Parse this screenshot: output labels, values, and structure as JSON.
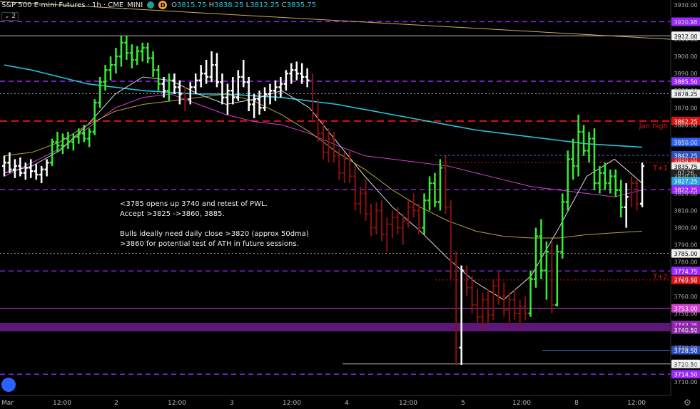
{
  "header": {
    "symbol": "S&P 500 E-mini Futures",
    "interval": "1h",
    "exchange": "CME_MINI",
    "badge": "D",
    "ohlc": {
      "o_label": "O",
      "o": "3815.75",
      "h_label": "H",
      "h": "3838.25",
      "l_label": "L",
      "l": "3812.25",
      "c_label": "C",
      "c": "3835.75"
    },
    "indicators_collapsed": "2"
  },
  "annotation_text": "<3785 opens up 3740 and retest of PWL.\nAccept >3825 ->3860, 3885.\n\nBulls ideally need daily close >3820 (approx 50dma)\n>3860 for potential test of ATH in future sessions.",
  "colors": {
    "bg": "#000000",
    "up": "#33ee33",
    "down": "#8b1010",
    "neutral": "#ffffff",
    "purple": "#9c27ff",
    "red_level": "#e01010",
    "cyan": "#26c6da",
    "tan": "#c8b060",
    "magenta": "#d040d0",
    "grey_line": "#cccccc"
  },
  "chart_data": {
    "type": "candlestick",
    "title": "S&P 500 E-mini Futures 1h",
    "y_range": [
      3705,
      3935
    ],
    "y_ticks": [
      "3930.00",
      "3920.00",
      "3910.00",
      "3900.00",
      "3890.00",
      "3880.00",
      "3870.00",
      "3860.00",
      "3850.00",
      "3840.00",
      "3830.00",
      "3820.00",
      "3810.00",
      "3800.00",
      "3790.00",
      "3780.00",
      "3770.00",
      "3760.00",
      "3750.00",
      "3740.00",
      "3730.00",
      "3720.00",
      "3710.00"
    ],
    "x_labels": [
      "Mar",
      "12:00",
      "2",
      "12:00",
      "3",
      "12:00",
      "4",
      "12:00",
      "5",
      "12:00",
      "8",
      "12:00"
    ],
    "levels": [
      {
        "value": 3920.25,
        "label": "3920.25",
        "style": "purple-dash"
      },
      {
        "value": 3912.0,
        "label": "3912.00",
        "style": "white-solid"
      },
      {
        "value": 3885.5,
        "label": "3885.50",
        "style": "purple-dash"
      },
      {
        "value": 3878.25,
        "label": "3878.25",
        "style": "white-dot"
      },
      {
        "value": 3862.25,
        "label": "3862.25",
        "style": "red-dash",
        "note": "Jan high"
      },
      {
        "value": 3850.0,
        "label": "3850.00",
        "style": "cyan"
      },
      {
        "value": 3842.25,
        "label": "3842.25",
        "style": "blue-dot"
      },
      {
        "value": 3838.0,
        "label": "3838.00",
        "style": "red-dot",
        "note": "T+1"
      },
      {
        "value": 3835.75,
        "label": "3835.75",
        "style": "price"
      },
      {
        "value": 3827.25,
        "label": "3827.25",
        "style": "cyan-tag"
      },
      {
        "value": 3822.25,
        "label": "3822.25",
        "style": "purple-dash"
      },
      {
        "value": 3785.0,
        "label": "3785.00",
        "style": "white-dot"
      },
      {
        "value": 3774.75,
        "label": "3774.75",
        "style": "purple-dash",
        "note": "T+2"
      },
      {
        "value": 3769.5,
        "label": "3769.50",
        "style": "red-dot"
      },
      {
        "value": 3753.0,
        "label": "3753.00",
        "style": "magenta-solid"
      },
      {
        "value": 3743.25,
        "label": "3743.25",
        "style": "purple-band"
      },
      {
        "value": 3740.5,
        "label": "3740.50",
        "style": "purple-band"
      },
      {
        "value": 3728.5,
        "label": "3728.50",
        "style": "blue-solid"
      },
      {
        "value": 3720.5,
        "label": "3720.50",
        "style": "white-solid"
      },
      {
        "value": 3714.5,
        "label": "3714.50",
        "style": "purple-dash"
      }
    ],
    "countdown": "07:26",
    "series_candles_note": "OHLC values for each hourly bar",
    "candles": [
      [
        3836,
        3842,
        3830,
        3838,
        "w"
      ],
      [
        3838,
        3844,
        3832,
        3834,
        "w"
      ],
      [
        3834,
        3840,
        3829,
        3836,
        "w"
      ],
      [
        3836,
        3841,
        3830,
        3832,
        "w"
      ],
      [
        3832,
        3838,
        3828,
        3835,
        "w"
      ],
      [
        3835,
        3840,
        3829,
        3833,
        "w"
      ],
      [
        3833,
        3837,
        3828,
        3831,
        "w"
      ],
      [
        3831,
        3836,
        3826,
        3834,
        "w"
      ],
      [
        3834,
        3840,
        3830,
        3838,
        "w"
      ],
      [
        3838,
        3852,
        3836,
        3850,
        "u"
      ],
      [
        3850,
        3856,
        3844,
        3848,
        "u"
      ],
      [
        3848,
        3855,
        3843,
        3852,
        "u"
      ],
      [
        3852,
        3856,
        3846,
        3850,
        "u"
      ],
      [
        3850,
        3855,
        3845,
        3853,
        "u"
      ],
      [
        3853,
        3858,
        3849,
        3855,
        "u"
      ],
      [
        3855,
        3860,
        3850,
        3852,
        "u"
      ],
      [
        3852,
        3858,
        3847,
        3856,
        "u"
      ],
      [
        3856,
        3875,
        3854,
        3873,
        "u"
      ],
      [
        3873,
        3888,
        3870,
        3885,
        "u"
      ],
      [
        3885,
        3895,
        3880,
        3892,
        "u"
      ],
      [
        3892,
        3900,
        3886,
        3895,
        "u"
      ],
      [
        3895,
        3905,
        3890,
        3900,
        "u"
      ],
      [
        3900,
        3912,
        3894,
        3908,
        "u"
      ],
      [
        3908,
        3912,
        3898,
        3902,
        "u"
      ],
      [
        3902,
        3907,
        3893,
        3898,
        "u"
      ],
      [
        3898,
        3906,
        3895,
        3903,
        "u"
      ],
      [
        3903,
        3908,
        3897,
        3905,
        "u"
      ],
      [
        3905,
        3908,
        3896,
        3899,
        "u"
      ],
      [
        3899,
        3903,
        3888,
        3892,
        "u"
      ],
      [
        3892,
        3895,
        3880,
        3884,
        "u"
      ],
      [
        3884,
        3888,
        3876,
        3880,
        "w"
      ],
      [
        3880,
        3890,
        3874,
        3886,
        "u"
      ],
      [
        3886,
        3890,
        3878,
        3882,
        "w"
      ],
      [
        3882,
        3886,
        3872,
        3878,
        "w"
      ],
      [
        3878,
        3882,
        3868,
        3875,
        "d"
      ],
      [
        3875,
        3885,
        3872,
        3882,
        "w"
      ],
      [
        3882,
        3890,
        3878,
        3886,
        "w"
      ],
      [
        3886,
        3895,
        3882,
        3890,
        "w"
      ],
      [
        3890,
        3898,
        3884,
        3888,
        "w"
      ],
      [
        3888,
        3903,
        3885,
        3895,
        "w"
      ],
      [
        3895,
        3902,
        3882,
        3885,
        "w"
      ],
      [
        3885,
        3890,
        3872,
        3876,
        "w"
      ],
      [
        3876,
        3884,
        3866,
        3880,
        "w"
      ],
      [
        3880,
        3888,
        3872,
        3876,
        "w"
      ],
      [
        3876,
        3892,
        3874,
        3888,
        "w"
      ],
      [
        3888,
        3898,
        3882,
        3885,
        "w"
      ],
      [
        3885,
        3888,
        3868,
        3872,
        "w"
      ],
      [
        3872,
        3878,
        3864,
        3875,
        "w"
      ],
      [
        3875,
        3880,
        3866,
        3870,
        "w"
      ],
      [
        3870,
        3882,
        3868,
        3878,
        "w"
      ],
      [
        3878,
        3884,
        3872,
        3880,
        "w"
      ],
      [
        3880,
        3886,
        3874,
        3882,
        "w"
      ],
      [
        3882,
        3888,
        3876,
        3884,
        "w"
      ],
      [
        3884,
        3892,
        3880,
        3890,
        "w"
      ],
      [
        3890,
        3896,
        3884,
        3892,
        "w"
      ],
      [
        3892,
        3897,
        3886,
        3890,
        "w"
      ],
      [
        3890,
        3896,
        3884,
        3888,
        "w"
      ],
      [
        3888,
        3893,
        3882,
        3886,
        "w"
      ],
      [
        3886,
        3890,
        3862,
        3866,
        "d"
      ],
      [
        3866,
        3875,
        3850,
        3855,
        "d"
      ],
      [
        3855,
        3862,
        3840,
        3844,
        "d"
      ],
      [
        3844,
        3858,
        3838,
        3852,
        "d"
      ],
      [
        3852,
        3856,
        3838,
        3842,
        "d"
      ],
      [
        3842,
        3846,
        3828,
        3832,
        "d"
      ],
      [
        3832,
        3844,
        3826,
        3840,
        "d"
      ],
      [
        3840,
        3845,
        3826,
        3830,
        "d"
      ],
      [
        3830,
        3836,
        3810,
        3814,
        "d"
      ],
      [
        3814,
        3824,
        3808,
        3820,
        "d"
      ],
      [
        3820,
        3828,
        3804,
        3808,
        "d"
      ],
      [
        3808,
        3814,
        3795,
        3800,
        "d"
      ],
      [
        3800,
        3815,
        3796,
        3810,
        "d"
      ],
      [
        3810,
        3816,
        3792,
        3796,
        "d"
      ],
      [
        3796,
        3806,
        3786,
        3802,
        "d"
      ],
      [
        3802,
        3810,
        3794,
        3806,
        "d"
      ],
      [
        3806,
        3812,
        3796,
        3800,
        "d"
      ],
      [
        3800,
        3808,
        3790,
        3804,
        "d"
      ],
      [
        3804,
        3816,
        3800,
        3812,
        "d"
      ],
      [
        3812,
        3820,
        3806,
        3810,
        "d"
      ],
      [
        3810,
        3814,
        3796,
        3800,
        "d"
      ],
      [
        3800,
        3820,
        3796,
        3816,
        "u"
      ],
      [
        3816,
        3830,
        3810,
        3826,
        "u"
      ],
      [
        3826,
        3832,
        3812,
        3815,
        "u"
      ],
      [
        3815,
        3840,
        3810,
        3835,
        "u"
      ],
      [
        3835,
        3842,
        3808,
        3812,
        "d"
      ],
      [
        3812,
        3816,
        3770,
        3780,
        "d"
      ],
      [
        3780,
        3786,
        3720,
        3730,
        "d"
      ],
      [
        3730,
        3778,
        3720,
        3775,
        "w"
      ],
      [
        3775,
        3778,
        3760,
        3765,
        "d"
      ],
      [
        3765,
        3772,
        3750,
        3755,
        "d"
      ],
      [
        3755,
        3764,
        3744,
        3748,
        "d"
      ],
      [
        3748,
        3762,
        3740,
        3758,
        "d"
      ],
      [
        3758,
        3764,
        3744,
        3749,
        "d"
      ],
      [
        3749,
        3770,
        3746,
        3766,
        "d"
      ],
      [
        3766,
        3774,
        3755,
        3760,
        "d"
      ],
      [
        3760,
        3768,
        3748,
        3752,
        "d"
      ],
      [
        3752,
        3762,
        3742,
        3758,
        "d"
      ],
      [
        3758,
        3764,
        3746,
        3750,
        "d"
      ],
      [
        3750,
        3758,
        3742,
        3754,
        "d"
      ],
      [
        3754,
        3760,
        3746,
        3750,
        "d"
      ],
      [
        3750,
        3775,
        3748,
        3770,
        "u"
      ],
      [
        3770,
        3800,
        3765,
        3795,
        "u"
      ],
      [
        3795,
        3805,
        3770,
        3775,
        "u"
      ],
      [
        3775,
        3792,
        3758,
        3786,
        "u"
      ],
      [
        3786,
        3792,
        3750,
        3755,
        "d"
      ],
      [
        3755,
        3790,
        3754,
        3786,
        "u"
      ],
      [
        3786,
        3820,
        3782,
        3815,
        "u"
      ],
      [
        3815,
        3845,
        3810,
        3840,
        "u"
      ],
      [
        3840,
        3852,
        3828,
        3836,
        "u"
      ],
      [
        3836,
        3866,
        3830,
        3856,
        "u"
      ],
      [
        3856,
        3860,
        3842,
        3845,
        "u"
      ],
      [
        3845,
        3856,
        3838,
        3852,
        "u"
      ],
      [
        3852,
        3858,
        3822,
        3826,
        "u"
      ],
      [
        3826,
        3836,
        3820,
        3832,
        "u"
      ],
      [
        3832,
        3838,
        3822,
        3826,
        "u"
      ],
      [
        3826,
        3834,
        3820,
        3830,
        "u"
      ],
      [
        3830,
        3834,
        3818,
        3822,
        "u"
      ],
      [
        3822,
        3828,
        3806,
        3812,
        "u"
      ],
      [
        3812,
        3826,
        3800,
        3818,
        "w"
      ],
      [
        3818,
        3830,
        3812,
        3826,
        "d"
      ],
      [
        3826,
        3828,
        3810,
        3814,
        "d"
      ],
      [
        3814,
        3838,
        3812,
        3836,
        "w"
      ]
    ],
    "moving_averages": [
      {
        "name": "cyan",
        "color": "#26c6da",
        "values": [
          3895,
          3892,
          3888,
          3884,
          3882,
          3880,
          3879,
          3878,
          3878,
          3877,
          3876,
          3874,
          3872,
          3869,
          3866,
          3863,
          3860,
          3857,
          3855,
          3853,
          3851,
          3849,
          3848,
          3847
        ]
      },
      {
        "name": "magenta",
        "color": "#d040d0",
        "values": [
          3830,
          3838,
          3846,
          3858,
          3870,
          3876,
          3878,
          3872,
          3866,
          3862,
          3860,
          3855,
          3848,
          3842,
          3840,
          3838,
          3836,
          3832,
          3828,
          3824,
          3822,
          3820,
          3818,
          3822
        ]
      },
      {
        "name": "white",
        "color": "#dddddd",
        "values": [
          3832,
          3836,
          3845,
          3860,
          3878,
          3888,
          3886,
          3878,
          3872,
          3875,
          3880,
          3870,
          3850,
          3830,
          3812,
          3798,
          3782,
          3768,
          3758,
          3772,
          3800,
          3830,
          3840,
          3826
        ]
      },
      {
        "name": "tan",
        "color": "#b8a040",
        "values": [
          3842,
          3844,
          3850,
          3860,
          3868,
          3872,
          3874,
          3876,
          3878,
          3874,
          3866,
          3856,
          3844,
          3834,
          3822,
          3812,
          3804,
          3798,
          3795,
          3794,
          3794,
          3796,
          3797,
          3798
        ]
      }
    ],
    "trendline": {
      "color": "#c8b060",
      "from_value": 3932,
      "to_value": 3910
    }
  }
}
